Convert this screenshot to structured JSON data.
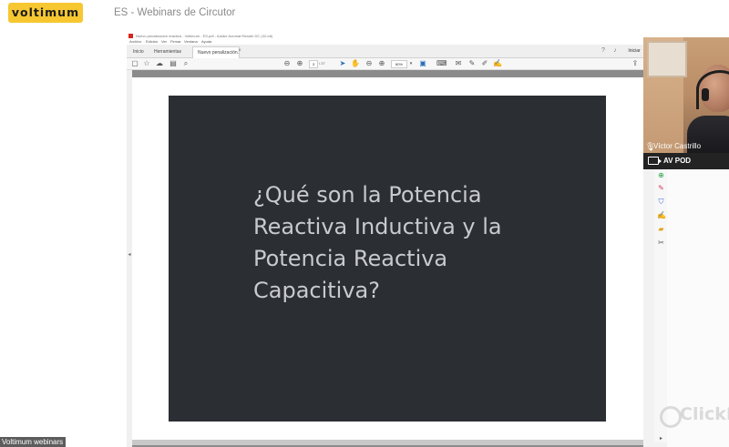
{
  "app": {
    "logo_text": "voltimum",
    "webinar_title": "ES - Webinars de Circutor",
    "footer_label": "Voltimum webinars",
    "watermark_brand": "ClickM"
  },
  "acrobat": {
    "window_title": "Nuevo penalización reactiva - Voltimum - ES.pdf - Adobe Acrobat Reader DC (32-bit)",
    "menu": [
      "Archivo",
      "Edición",
      "Ver",
      "Firmar",
      "Ventana",
      "Ayuda"
    ],
    "tabs": [
      {
        "label": "Inicio"
      },
      {
        "label": "Herramientas"
      },
      {
        "label": "Nuevo penalización..."
      }
    ],
    "tab_close": "×",
    "sign_in": "Iniciar",
    "page_current": "3",
    "page_total": "/ 27",
    "zoom": "80%"
  },
  "slide": {
    "lines": [
      "¿Qué son la Potencia",
      "Reactiva Inductiva y la",
      "Potencia Reactiva",
      "Capacitiva?"
    ]
  },
  "video": {
    "speaker_name": "Víctor Castrillo",
    "stream_label": "AV POD"
  },
  "colors": {
    "logo_bg": "#f6c731",
    "slide_bg": "#2b2e33",
    "slide_text": "#c8cacd",
    "av_bar": "#232323"
  }
}
